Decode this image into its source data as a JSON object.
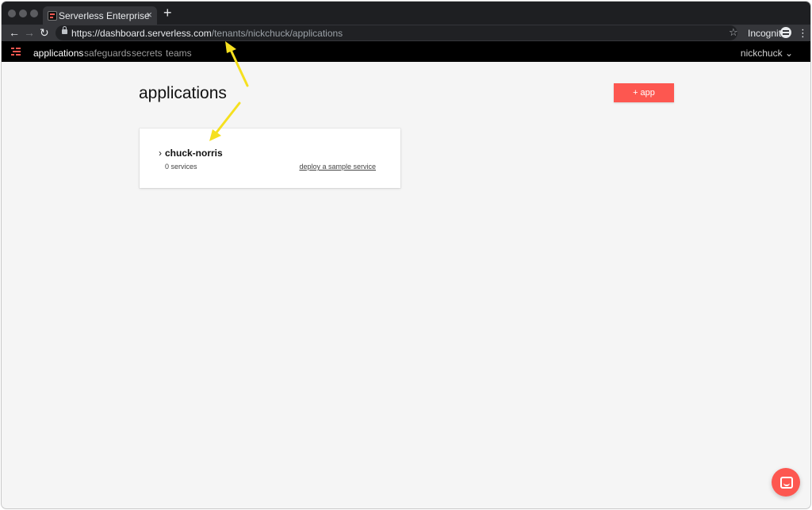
{
  "browser": {
    "tab_title": "Serverless Enterprise",
    "tab_close": "×",
    "new_tab": "+",
    "back": "←",
    "forward": "→",
    "reload": "↻",
    "url_host": "https://dashboard.serverless.com",
    "url_path": "/tenants/nickchuck/applications",
    "bookmark_star": "☆",
    "incognito_label": "Incognito",
    "menu": "⋮"
  },
  "navbar": {
    "items": [
      {
        "label": "applications",
        "active": true
      },
      {
        "label": "safeguards",
        "active": false
      },
      {
        "label": "secrets",
        "active": false
      },
      {
        "label": "teams",
        "active": false
      }
    ],
    "user": "nickchuck ⌄"
  },
  "main": {
    "title": "applications",
    "add_button_label": "+ app",
    "apps": [
      {
        "chevron": "›",
        "name": "chuck-norris",
        "services": "0 services",
        "action": "deploy a sample service"
      }
    ]
  },
  "colors": {
    "brand": "#fd5750",
    "annotation_arrow": "#f5e01f",
    "navbar_bg": "#000000",
    "page_bg": "#f5f5f5"
  },
  "icons": {
    "logo": "serverless-logo-icon",
    "chat": "chat-icon",
    "incognito": "incognito-icon",
    "lock": "lock-icon"
  }
}
